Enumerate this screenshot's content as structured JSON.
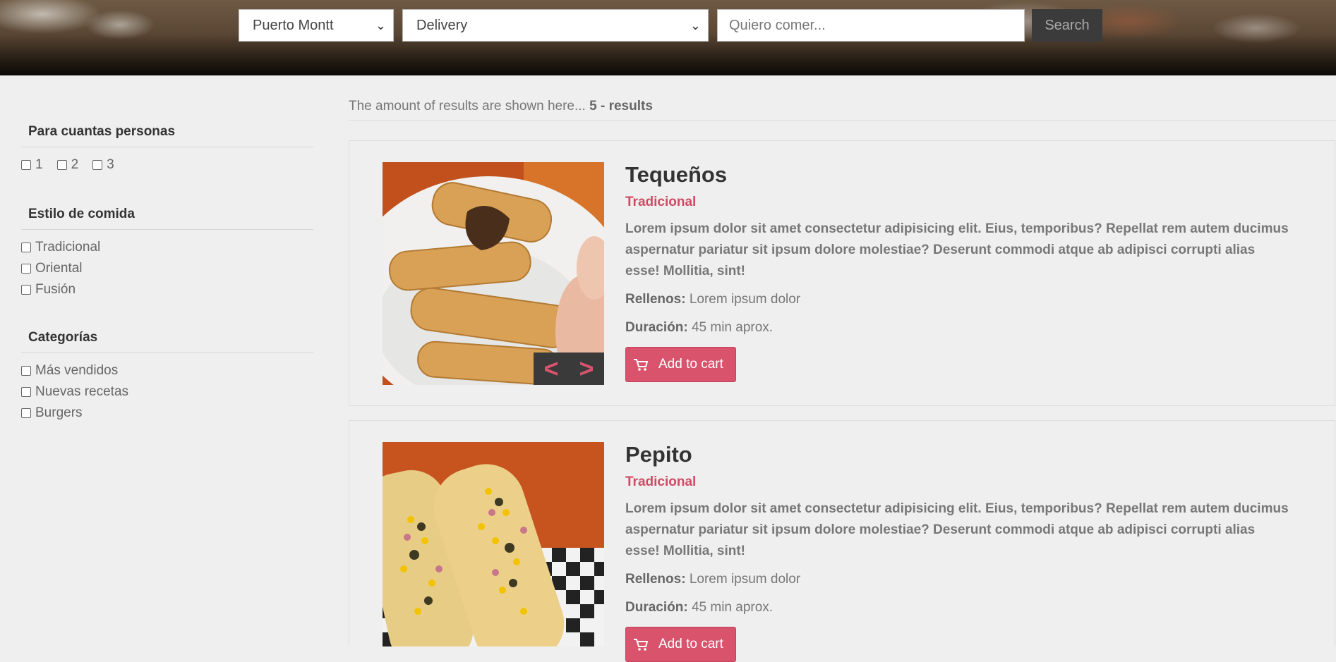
{
  "header": {
    "city": "Puerto Montt",
    "mode": "Delivery",
    "search_placeholder": "Quiero comer...",
    "search_button": "Search"
  },
  "sidebar": {
    "people": {
      "title": "Para cuantas personas",
      "options": [
        "1",
        "2",
        "3"
      ]
    },
    "style": {
      "title": "Estilo de comida",
      "options": [
        "Tradicional",
        "Oriental",
        "Fusión"
      ]
    },
    "categories": {
      "title": "Categorías",
      "options": [
        "Más vendidos",
        "Nuevas recetas",
        "Burgers"
      ]
    }
  },
  "results": {
    "prefix": "The amount of results are shown here...",
    "count_label": "5 - results"
  },
  "products": [
    {
      "name": "Tequeños",
      "style": "Tradicional",
      "description": "Lorem ipsum dolor sit amet consectetur adipisicing elit. Eius, temporibus? Repellat rem autem ducimus aspernatur pariatur sit ipsum dolore molestiae? Deserunt commodi atque ab adipisci corrupti alias esse! Mollitia, sint!",
      "fillings_label": "Rellenos:",
      "fillings": "Lorem ipsum dolor",
      "duration_label": "Duración:",
      "duration": "45 min aprox.",
      "cart_label": "Add to cart",
      "prev": "<",
      "next": ">"
    },
    {
      "name": "Pepito",
      "style": "Tradicional",
      "description": "Lorem ipsum dolor sit amet consectetur adipisicing elit. Eius, temporibus? Repellat rem autem ducimus aspernatur pariatur sit ipsum dolore molestiae? Deserunt commodi atque ab adipisci corrupti alias esse! Mollitia, sint!",
      "fillings_label": "Rellenos:",
      "fillings": "Lorem ipsum dolor",
      "duration_label": "Duración:",
      "duration": "45 min aprox.",
      "cart_label": "Add to cart"
    }
  ],
  "colors": {
    "accent": "#d9536d",
    "background": "#eeefee",
    "dark_button": "#3b3b3b"
  }
}
